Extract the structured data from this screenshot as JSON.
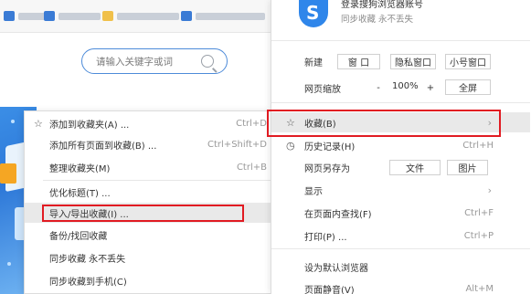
{
  "background": {
    "search": {
      "placeholder": "请输入关键字或词"
    }
  },
  "submenu": {
    "items": [
      {
        "label": "添加到收藏夹(A) ...",
        "shortcut": "Ctrl+D"
      },
      {
        "label": "添加所有页面到收藏(B) ...",
        "shortcut": "Ctrl+Shift+D"
      },
      {
        "label": "整理收藏夹(M)",
        "shortcut": "Ctrl+B"
      },
      {
        "label": "优化标题(T) ...",
        "shortcut": ""
      },
      {
        "label": "导入/导出收藏(I) ...",
        "shortcut": ""
      },
      {
        "label": "备份/找回收藏",
        "shortcut": ""
      },
      {
        "label": "同步收藏 永不丢失",
        "shortcut": ""
      },
      {
        "label": "同步收藏到手机(C)",
        "shortcut": ""
      }
    ]
  },
  "mainmenu": {
    "account_title": "登录搜狗浏览器账号",
    "account_sub": "同步收藏 永不丢失",
    "new_label": "新建",
    "new_window": "窗 口",
    "private_window": "隐私窗口",
    "small_window": "小号窗口",
    "zoom_label": "网页缩放",
    "zoom_minus": "-",
    "zoom_value": "100%",
    "zoom_plus": "+",
    "fullscreen": "全屏",
    "favorites": "收藏(B)",
    "history": "历史记录(H)",
    "history_shortcut": "Ctrl+H",
    "save_as": "网页另存为",
    "save_file": "文件",
    "save_image": "图片",
    "display": "显示",
    "find": "在页面内查找(F)",
    "find_shortcut": "Ctrl+F",
    "print": "打印(P) ...",
    "print_shortcut": "Ctrl+P",
    "set_default": "设为默认浏览器",
    "mute": "页面静音(V)",
    "mute_shortcut": "Alt+M"
  }
}
